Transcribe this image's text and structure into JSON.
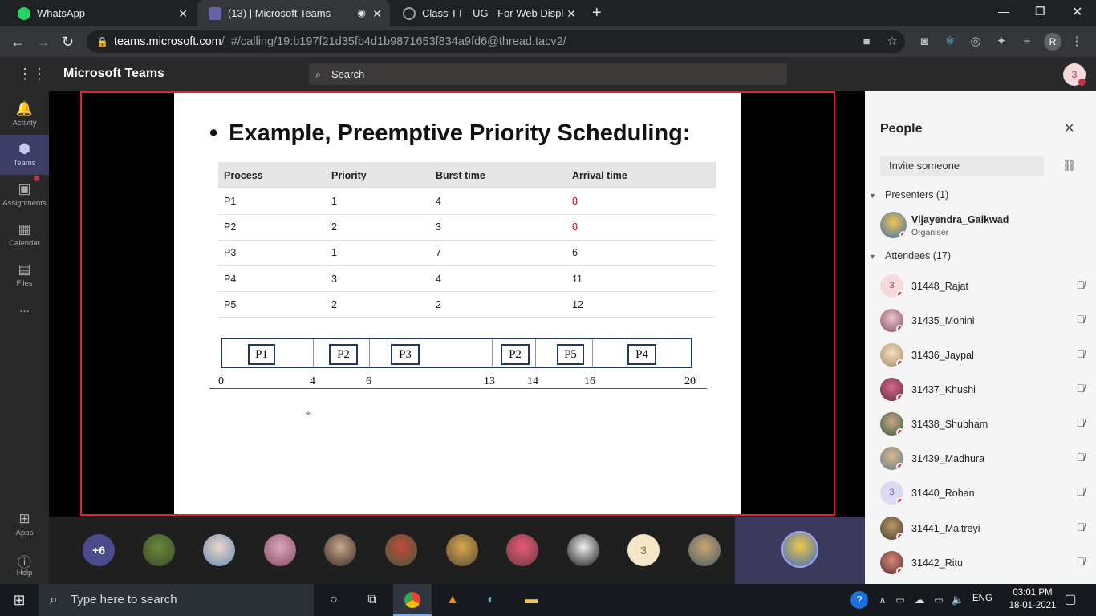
{
  "browser": {
    "tabs": [
      {
        "title": "WhatsApp",
        "icon": "whatsapp-icon",
        "color": "#25d366"
      },
      {
        "title": "(13) | Microsoft Teams",
        "icon": "teams-icon",
        "color": "#6264a7"
      },
      {
        "title": "Class TT - UG - For Web Display.p",
        "icon": "globe-icon",
        "color": "#9aa0a6"
      }
    ],
    "url_host": "teams.microsoft.com",
    "url_path": "/_#/calling/19:b197f21d35fb4d1b9871653f834a9fd6@thread.tacv2/",
    "profile_initial": "R"
  },
  "teams": {
    "app_title": "Microsoft Teams",
    "search_placeholder": "Search",
    "account_initial": "3",
    "rail": [
      {
        "label": "Activity",
        "icon": "bell-icon"
      },
      {
        "label": "Teams",
        "icon": "teams-group-icon"
      },
      {
        "label": "Assignments",
        "icon": "backpack-icon"
      },
      {
        "label": "Calendar",
        "icon": "calendar-icon"
      },
      {
        "label": "Files",
        "icon": "file-icon"
      },
      {
        "label": "...",
        "icon": "more-icon"
      }
    ],
    "rail_bottom": [
      {
        "label": "Apps",
        "icon": "apps-icon"
      },
      {
        "label": "Help",
        "icon": "help-icon"
      }
    ]
  },
  "slide": {
    "title": "Example, Preemptive Priority Scheduling:",
    "headers": [
      "Process",
      "Priority",
      "Burst time",
      "Arrival time"
    ],
    "rows": [
      [
        "P1",
        "1",
        "4",
        "0"
      ],
      [
        "P2",
        "2",
        "3",
        "0"
      ],
      [
        "P3",
        "1",
        "7",
        "6"
      ],
      [
        "P4",
        "3",
        "4",
        "11"
      ],
      [
        "P5",
        "2",
        "2",
        "12"
      ]
    ],
    "gantt_labels": [
      "P1",
      "P2",
      "P3",
      "P2",
      "P5",
      "P4"
    ],
    "gantt_ticks": [
      "0",
      "4",
      "6",
      "13",
      "14",
      "16",
      "20"
    ]
  },
  "gallery": {
    "overflow_count": "+6",
    "initial_avatar": "3"
  },
  "people": {
    "title": "People",
    "invite_placeholder": "Invite someone",
    "presenters_label": "Presenters (1)",
    "presenter": {
      "name": "Vijayendra_Gaikwad",
      "role": "Organiser"
    },
    "attendees_label": "Attendees (17)",
    "attendees": [
      {
        "name": "31448_Rajat",
        "initial": "3",
        "color": "#f4d9dd"
      },
      {
        "name": "31435_Mohini",
        "initial": "",
        "color": "#b47a8a"
      },
      {
        "name": "31436_Jaypal",
        "initial": "",
        "color": "#d9c9a8"
      },
      {
        "name": "31437_Khushi",
        "initial": "",
        "color": "#8a3a5a"
      },
      {
        "name": "31438_Shubham",
        "initial": "",
        "color": "#5a7a4a"
      },
      {
        "name": "31439_Madhura",
        "initial": "",
        "color": "#b08a5a"
      },
      {
        "name": "31440_Rohan",
        "initial": "3",
        "color": "#dcdaf0"
      },
      {
        "name": "31441_Maitreyi",
        "initial": "",
        "color": "#6a5a3a"
      },
      {
        "name": "31442_Ritu",
        "initial": "",
        "color": "#7a3a3a"
      }
    ]
  },
  "taskbar": {
    "search_placeholder": "Type here to search",
    "language": "ENG",
    "time": "03:01 PM",
    "date": "18-01-2021"
  }
}
